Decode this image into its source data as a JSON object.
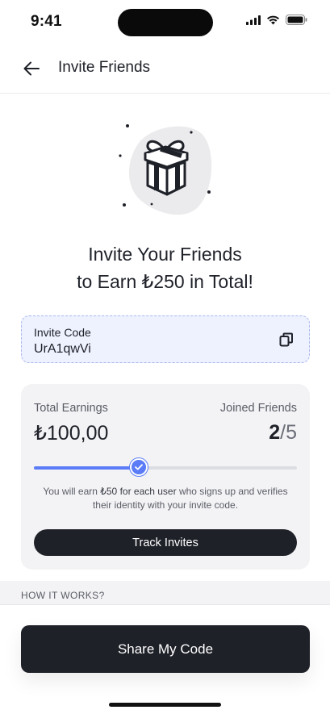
{
  "status_bar": {
    "time": "9:41",
    "icons": [
      "signal-icon",
      "wifi-icon",
      "battery-icon"
    ]
  },
  "header": {
    "back_icon": "arrow-left-icon",
    "title": "Invite Friends"
  },
  "hero": {
    "illustration": "gift-box-icon",
    "title_line1": "Invite Your Friends",
    "title_line2": "to Earn ₺250 in Total!"
  },
  "invite_code": {
    "label": "Invite Code",
    "value": "UrA1qwVi",
    "copy_icon": "copy-icon"
  },
  "earnings": {
    "total_label": "Total Earnings",
    "total_value": "₺100,00",
    "friends_label": "Joined Friends",
    "friends_joined": "2",
    "friends_separator": "/",
    "friends_total": "5",
    "progress_fraction": 0.4,
    "note_part1": "You will earn ",
    "note_highlight": "₺50 for each user",
    "note_part2": " who signs up and verifies their identity with your invite code.",
    "track_button": "Track Invites"
  },
  "how_it_works": {
    "label": "HOW IT WORKS?"
  },
  "footer": {
    "share_button": "Share My Code"
  },
  "colors": {
    "accent": "#5b7cf6",
    "dark": "#1f2129",
    "code_bg": "#eef2fe",
    "card_bg": "#f3f3f5"
  }
}
